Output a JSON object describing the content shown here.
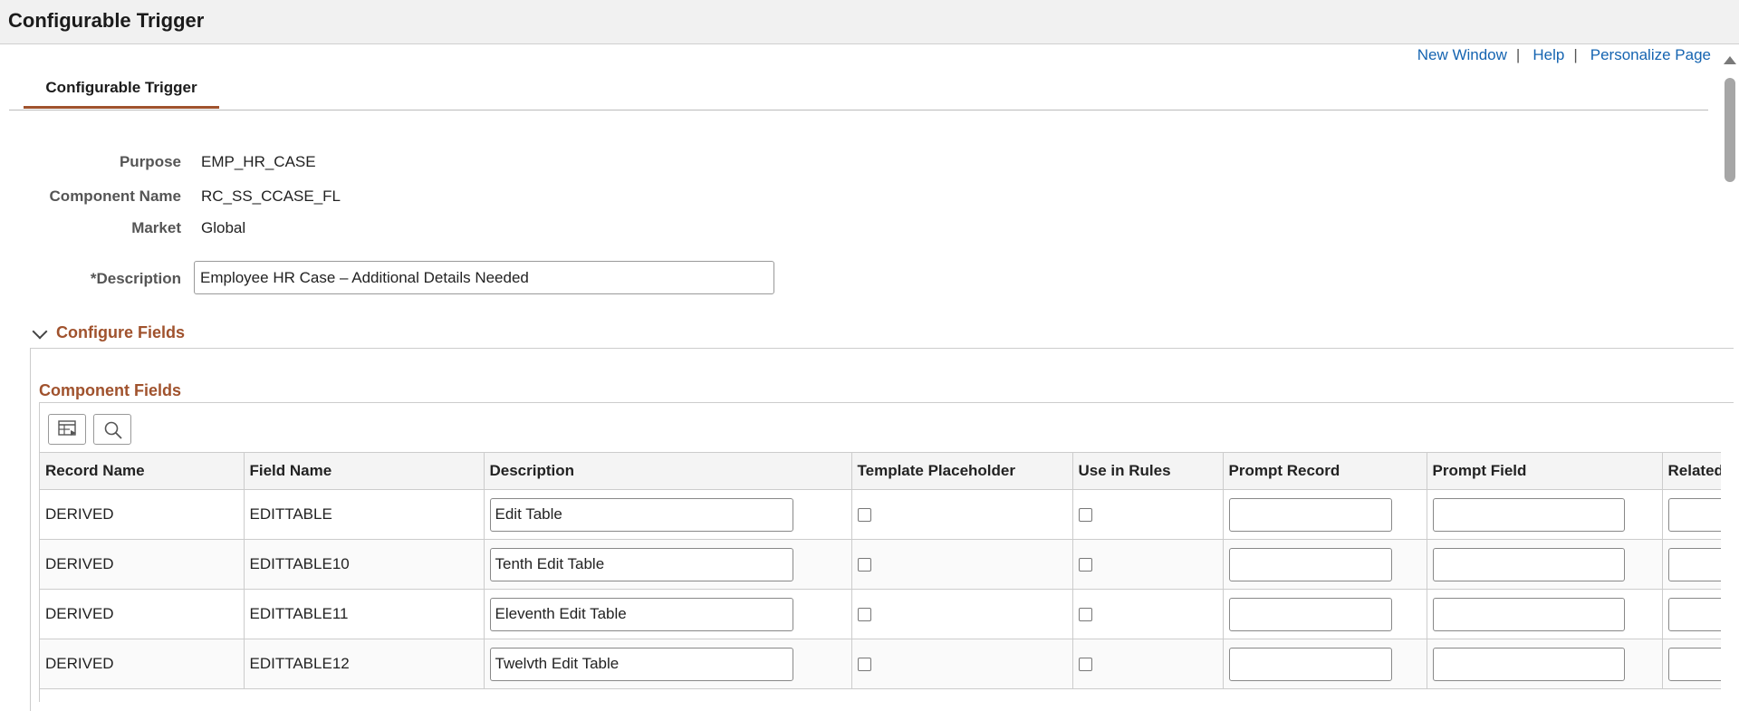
{
  "page": {
    "title": "Configurable Trigger"
  },
  "links": {
    "new_window": "New Window",
    "help": "Help",
    "personalize": "Personalize Page",
    "separator": "|"
  },
  "tabs": [
    {
      "label": "Configurable Trigger",
      "active": true
    }
  ],
  "info": {
    "purpose_label": "Purpose",
    "purpose_value": "EMP_HR_CASE",
    "component_label": "Component Name",
    "component_value": "RC_SS_CCASE_FL",
    "market_label": "Market",
    "market_value": "Global",
    "description_label": "*Description",
    "description_value": "Employee HR Case – Additional Details Needed"
  },
  "section": {
    "title": "Configure Fields"
  },
  "grid": {
    "title": "Component Fields",
    "tools": [
      "personalize-grid-icon",
      "search-icon"
    ],
    "columns": [
      "Record Name",
      "Field Name",
      "Description",
      "Template Placeholder",
      "Use in Rules",
      "Prompt Record",
      "Prompt Field",
      "Related"
    ],
    "rows": [
      {
        "record": "DERIVED",
        "field": "EDITTABLE",
        "description": "Edit Table",
        "template_placeholder": false,
        "use_in_rules": false,
        "prompt_record": "",
        "prompt_field": "",
        "related": ""
      },
      {
        "record": "DERIVED",
        "field": "EDITTABLE10",
        "description": "Tenth Edit Table",
        "template_placeholder": false,
        "use_in_rules": false,
        "prompt_record": "",
        "prompt_field": "",
        "related": ""
      },
      {
        "record": "DERIVED",
        "field": "EDITTABLE11",
        "description": "Eleventh Edit Table",
        "template_placeholder": false,
        "use_in_rules": false,
        "prompt_record": "",
        "prompt_field": "",
        "related": ""
      },
      {
        "record": "DERIVED",
        "field": "EDITTABLE12",
        "description": "Twelvth Edit Table",
        "template_placeholder": false,
        "use_in_rules": false,
        "prompt_record": "",
        "prompt_field": "",
        "related": ""
      }
    ]
  },
  "colors": {
    "accent": "#a0522d",
    "link": "#1564b1"
  }
}
